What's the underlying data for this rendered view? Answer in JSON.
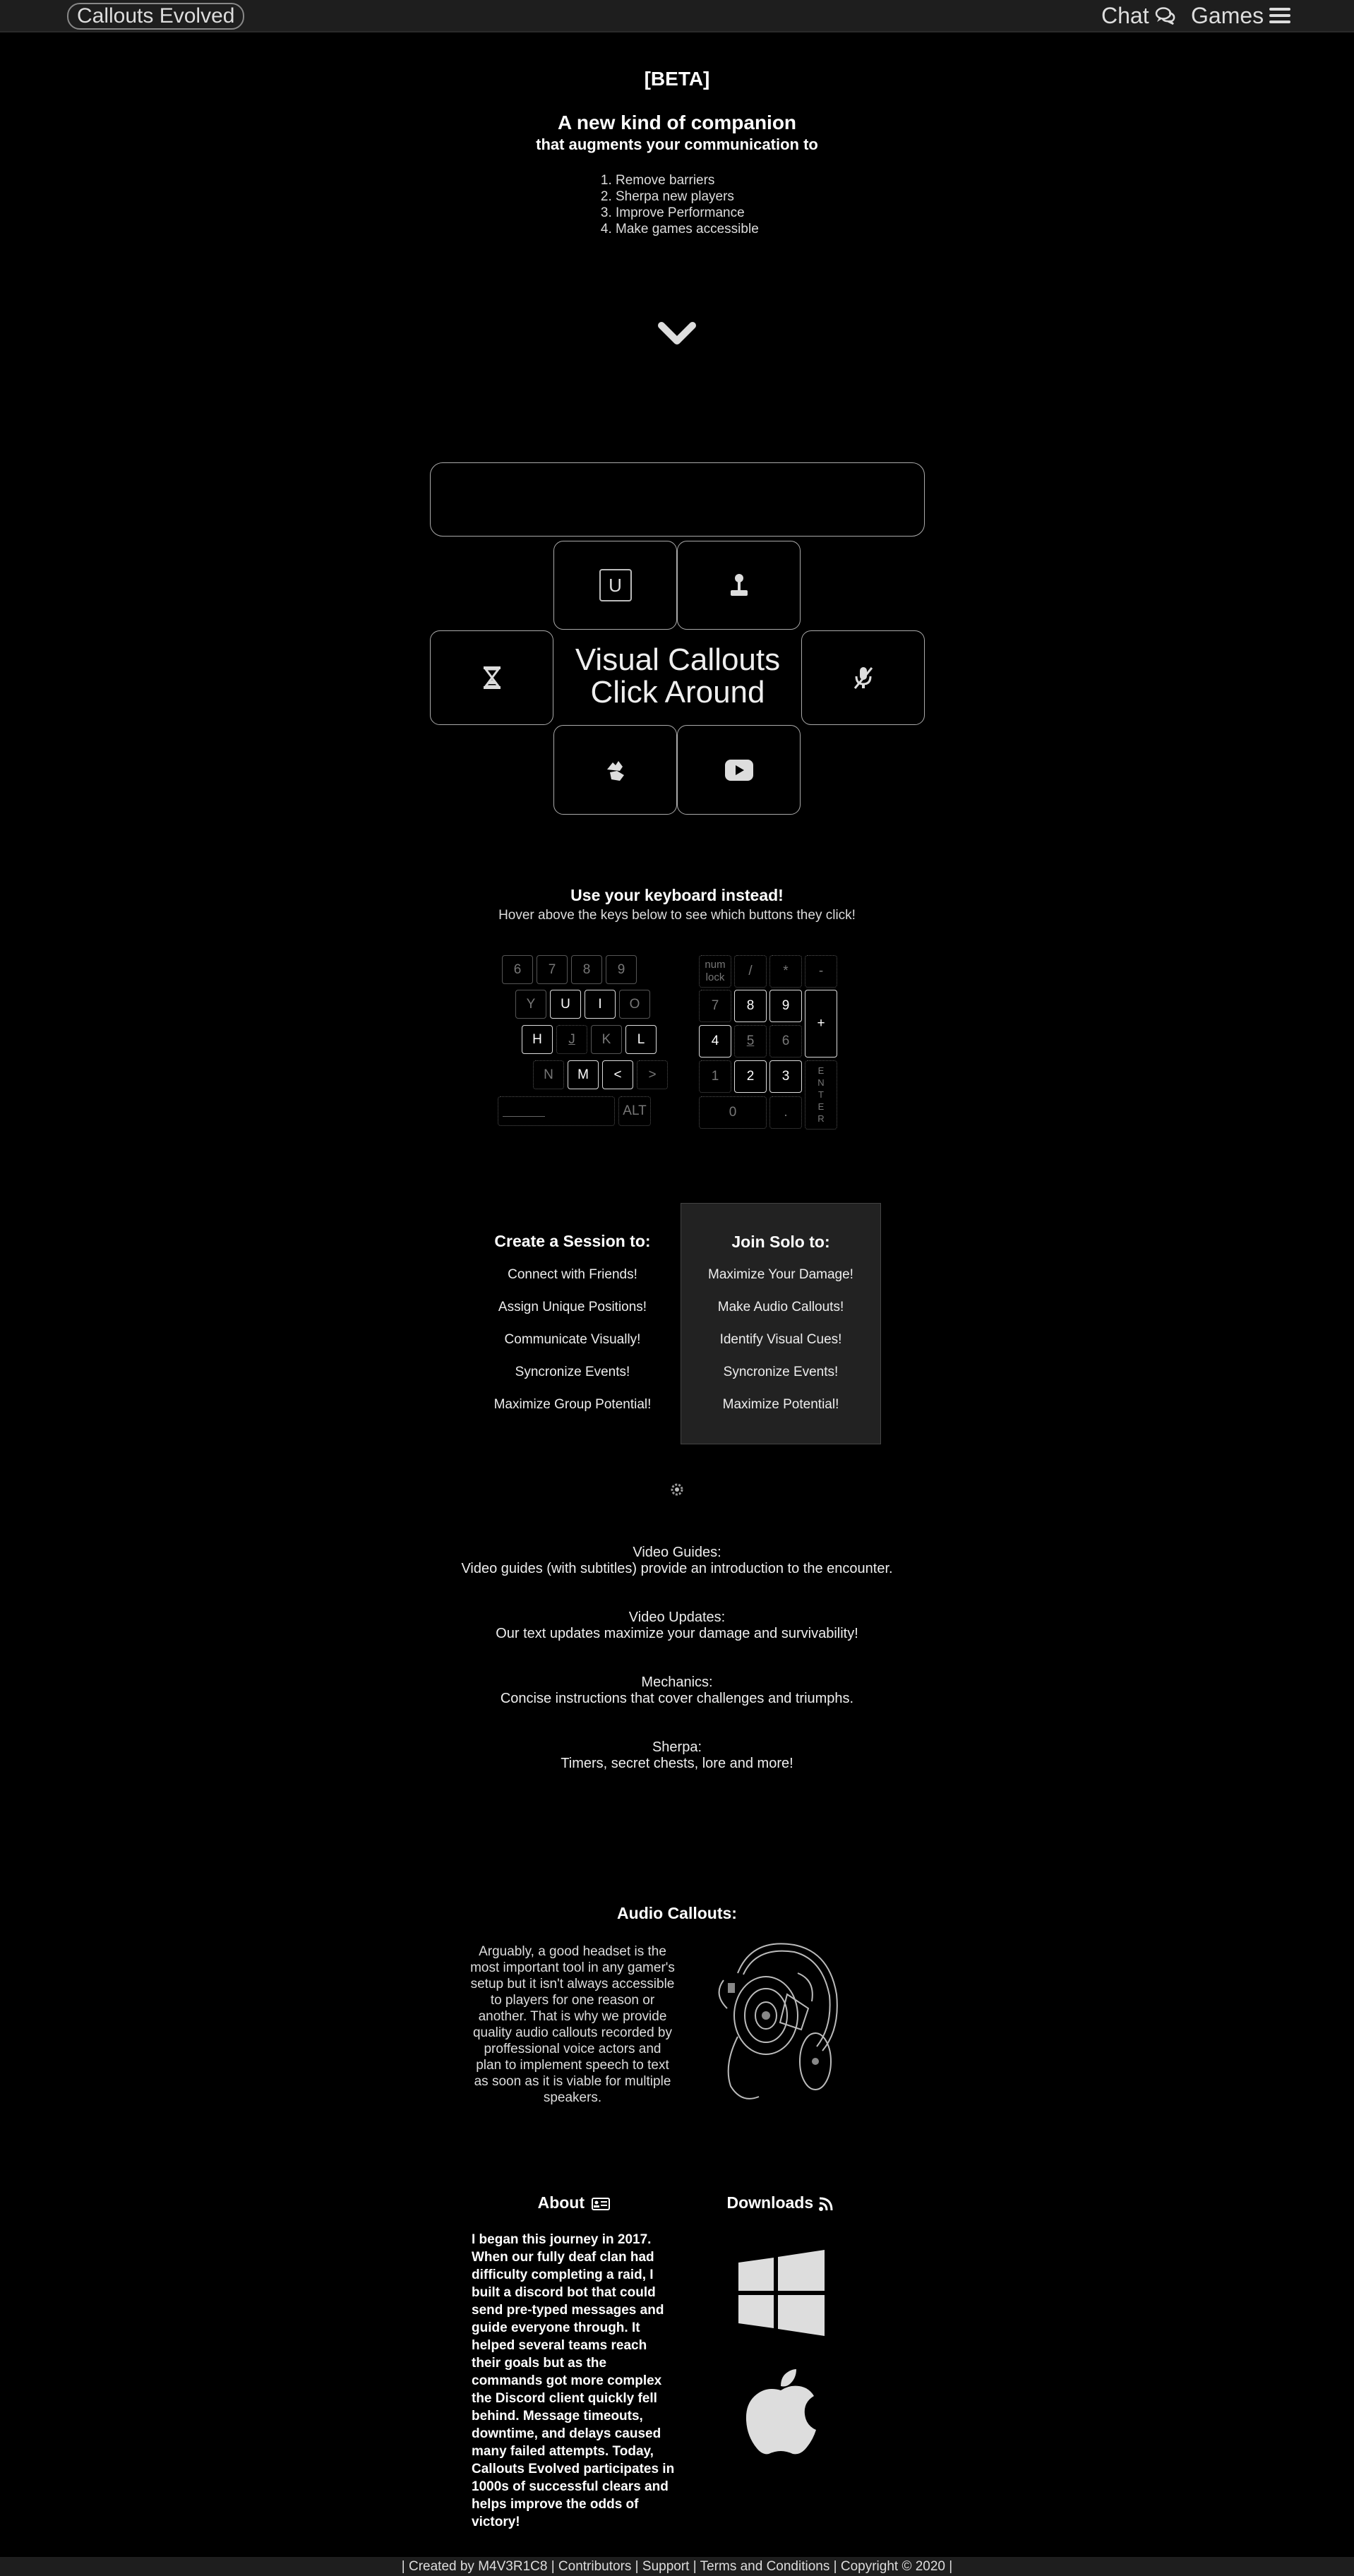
{
  "nav": {
    "brand": "Callouts Evolved",
    "chat_label": "Chat",
    "games_label": "Games"
  },
  "hero": {
    "badge": "[BETA]",
    "headline": "A new kind of companion",
    "subheadline": "that augments your communication to",
    "goals": [
      "Remove barriers",
      "Sherpa new players",
      "Improve Performance",
      "Make games accessible"
    ]
  },
  "callout_panel": {
    "input_value": "",
    "title_line1": "Visual Callouts",
    "title_line2": "Click Around",
    "u_key": "U"
  },
  "keyboard": {
    "title": "Use your keyboard instead!",
    "hint": "Hover above the keys below to see which buttons they click!",
    "main_keys": [
      "6",
      "7",
      "8",
      "9",
      "Y",
      "U",
      "I",
      "O",
      "H",
      "J",
      "K",
      "L",
      "N",
      "M",
      "<",
      ">",
      "ALT"
    ],
    "numpad_keys": [
      "num lock",
      "/",
      "*",
      "-",
      "7",
      "8",
      "9",
      "+",
      "4",
      "5",
      "6",
      "1",
      "2",
      "3",
      "ENTER",
      "0",
      "."
    ]
  },
  "sessions": {
    "create": {
      "title": "Create a Session to:",
      "items": [
        "Connect with Friends!",
        "Assign Unique Positions!",
        "Communicate Visually!",
        "Syncronize Events!",
        "Maximize Group Potential!"
      ]
    },
    "solo": {
      "title": "Join Solo to:",
      "items": [
        "Maximize Your Damage!",
        "Make Audio Callouts!",
        "Identify Visual Cues!",
        "Syncronize Events!",
        "Maximize Potential!"
      ]
    }
  },
  "features": [
    {
      "title": "Video Guides:",
      "text": "Video guides (with subtitles) provide an introduction to the encounter."
    },
    {
      "title": "Video Updates:",
      "text": "Our text updates maximize your damage and survivability!"
    },
    {
      "title": "Mechanics:",
      "text": "Concise instructions that cover challenges and triumphs."
    },
    {
      "title": "Sherpa:",
      "text": "Timers, secret chests, lore and more!"
    }
  ],
  "audio": {
    "title": "Audio Callouts:",
    "text": "Arguably, a good headset is the most important tool in any gamer's setup but it isn't always accessible to players for one reason or another. That is why we provide quality audio callouts recorded by proffessional voice actors and plan to implement speech to text as soon as it is viable for multiple speakers."
  },
  "about": {
    "title": "About",
    "text": "I began this journey in 2017. When our fully deaf clan had difficulty completing a raid, I built a discord bot that could send pre-typed messages and guide everyone through. It helped several teams reach their goals but as the commands got more complex the Discord client quickly fell behind. Message timeouts, downtime, and delays caused many failed attempts. Today, Callouts Evolved participates in 1000s of successful clears and helps improve the odds of victory!"
  },
  "downloads": {
    "title": "Downloads"
  },
  "footer": {
    "text": "| Created by M4V3R1C8 | Contributors | Support | Terms and Conditions | Copyright © 2020 |"
  }
}
